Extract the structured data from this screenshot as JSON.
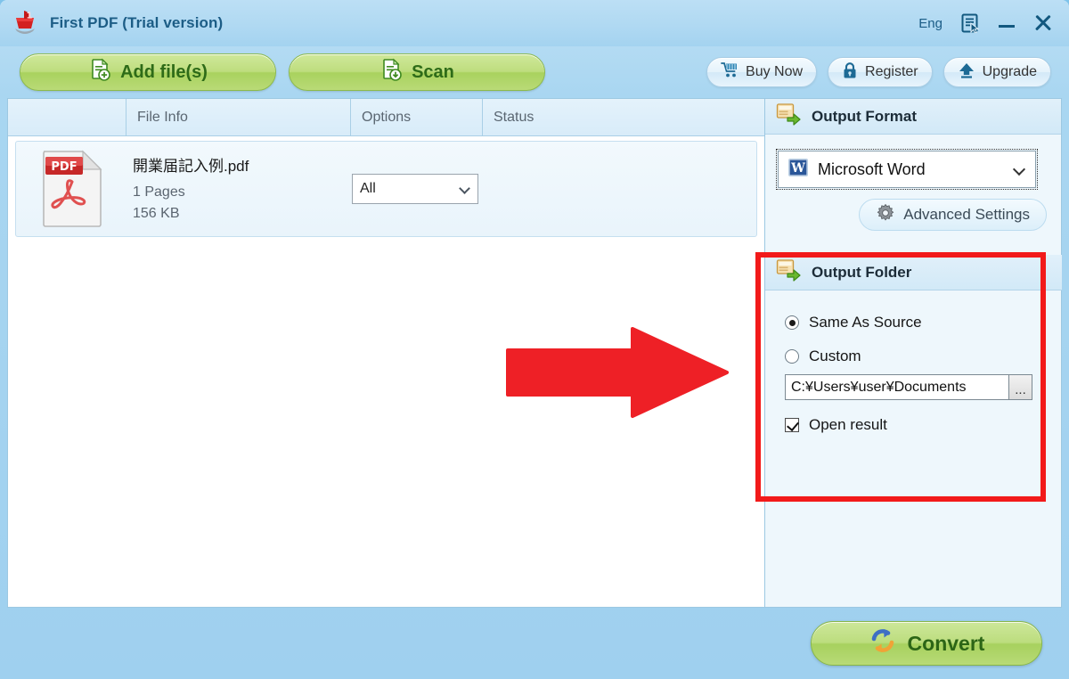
{
  "window": {
    "title": "First PDF (Trial version)",
    "app_icon": "ship-icon"
  },
  "titlebar": {
    "language": "Eng",
    "help_icon": "document-cursor-icon",
    "minimize_icon": "minimize-icon",
    "close_icon": "close-icon"
  },
  "toolbar": {
    "add_files_label": "Add file(s)",
    "add_files_icon": "document-plus-icon",
    "scan_label": "Scan",
    "scan_icon": "document-scan-icon",
    "buy_now_label": "Buy Now",
    "buy_now_icon": "shopping-cart-icon",
    "register_label": "Register",
    "register_icon": "lock-icon",
    "upgrade_label": "Upgrade",
    "upgrade_icon": "up-arrow-icon"
  },
  "file_list": {
    "columns": [
      "",
      "File Info",
      "Options",
      "Status"
    ],
    "rows": [
      {
        "icon": "pdf-file-icon",
        "name": "開業届記入例.pdf",
        "pages": "1 Pages",
        "size": "156 KB",
        "option_value": "All",
        "status": ""
      }
    ]
  },
  "output_format": {
    "header": "Output Format",
    "header_icon": "output-folder-icon",
    "selected_format": "Microsoft Word",
    "format_icon": "word-icon",
    "advanced_settings_label": "Advanced Settings",
    "advanced_settings_icon": "gear-icon"
  },
  "output_folder": {
    "header": "Output Folder",
    "header_icon": "output-folder-icon",
    "same_as_source_label": "Same As Source",
    "same_as_source_selected": true,
    "custom_label": "Custom",
    "custom_selected": false,
    "path_value": "C:¥Users¥user¥Documents",
    "browse_label": "...",
    "open_result_label": "Open result",
    "open_result_checked": true
  },
  "footer": {
    "convert_label": "Convert",
    "convert_icon": "refresh-circular-arrows-icon"
  },
  "annotations": {
    "highlight_color": "#f21a1a",
    "arrow_color": "#ef2128",
    "arrow_direction": "right"
  }
}
